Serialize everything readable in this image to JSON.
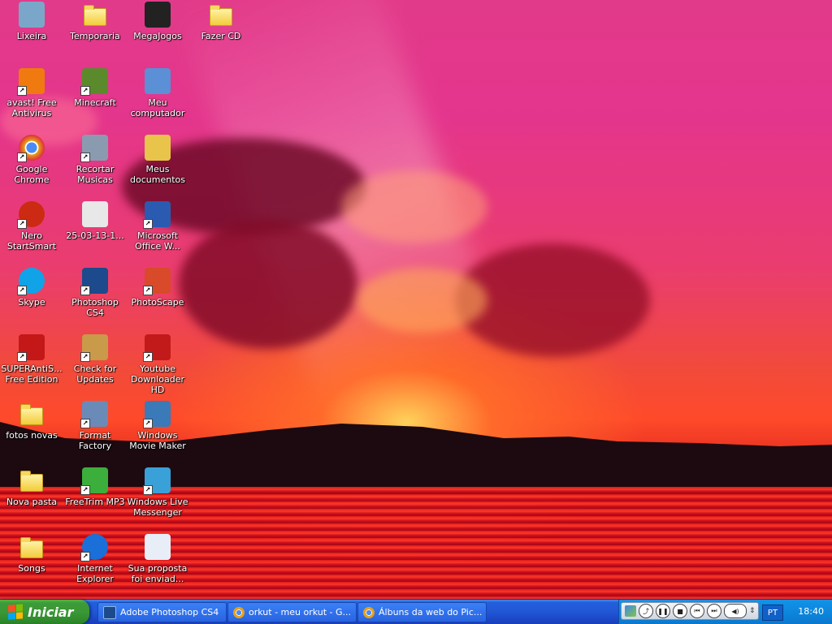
{
  "desktop": {
    "icons": [
      {
        "label": "Lixeira",
        "icon": "recycle-bin-icon"
      },
      {
        "label": "Temporaria",
        "icon": "folder-icon"
      },
      {
        "label": "MegaJogos",
        "icon": "megajogos-icon"
      },
      {
        "label": "Fazer CD",
        "icon": "folder-icon"
      },
      {
        "label": "avast! Free Antivirus",
        "icon": "avast-icon"
      },
      {
        "label": "Minecraft",
        "icon": "minecraft-icon"
      },
      {
        "label": "Meu computador",
        "icon": "computer-icon"
      },
      {
        "label": "Google Chrome",
        "icon": "chrome-icon"
      },
      {
        "label": "Recortar Musicas",
        "icon": "recortar-musicas-icon"
      },
      {
        "label": "Meus documentos",
        "icon": "documents-folder-icon"
      },
      {
        "label": "Nero StartSmart",
        "icon": "nero-icon"
      },
      {
        "label": "25-03-13-1...",
        "icon": "image-file-icon"
      },
      {
        "label": "Microsoft Office W...",
        "icon": "word-icon"
      },
      {
        "label": "Skype",
        "icon": "skype-icon"
      },
      {
        "label": "Photoshop CS4",
        "icon": "photoshop-icon"
      },
      {
        "label": "PhotoScape",
        "icon": "photoscape-icon"
      },
      {
        "label": "SUPERAntiS... Free Edition",
        "icon": "superantispyware-icon"
      },
      {
        "label": "Check for Updates",
        "icon": "update-box-icon"
      },
      {
        "label": "Youtube Downloader HD",
        "icon": "youtube-downloader-icon"
      },
      {
        "label": "fotos novas",
        "icon": "folder-icon"
      },
      {
        "label": "Format Factory",
        "icon": "format-factory-icon"
      },
      {
        "label": "Windows Movie Maker",
        "icon": "movie-maker-icon"
      },
      {
        "label": "Nova pasta",
        "icon": "folder-icon"
      },
      {
        "label": "FreeTrim MP3",
        "icon": "freetrim-icon"
      },
      {
        "label": "Windows Live Messenger",
        "icon": "messenger-icon"
      },
      {
        "label": "Songs",
        "icon": "folder-icon"
      },
      {
        "label": "Internet Explorer",
        "icon": "ie-icon"
      },
      {
        "label": "Sua proposta foi enviad...",
        "icon": "word-document-icon"
      }
    ]
  },
  "taskbar": {
    "start_label": "Iniciar",
    "tasks": [
      {
        "label": "Adobe Photoshop CS4",
        "icon": "photoshop-icon",
        "color": "#1c4a8c"
      },
      {
        "label": "orkut - meu orkut - G...",
        "icon": "chrome-icon",
        "color": "#e8a11a"
      },
      {
        "label": "Álbuns da web do Pic...",
        "icon": "chrome-icon",
        "color": "#e8a11a"
      }
    ],
    "tray": {
      "language": "PT",
      "clock": "18:40"
    }
  }
}
